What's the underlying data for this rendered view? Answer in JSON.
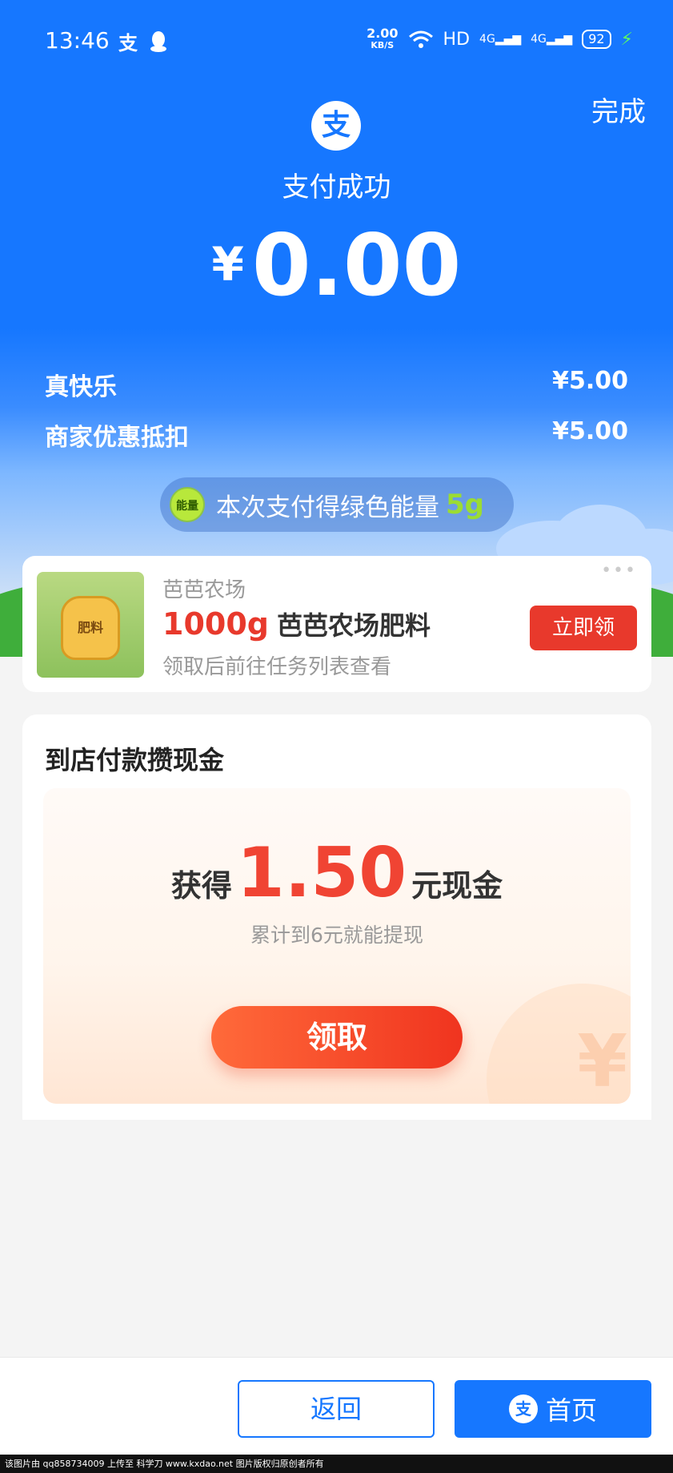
{
  "status_bar": {
    "time": "13:46",
    "speed_value": "2.00",
    "speed_unit": "KB/S",
    "hd": "HD",
    "net1": "4G",
    "net2": "4G",
    "battery": "92"
  },
  "header": {
    "done_label": "完成",
    "logo_glyph": "支",
    "title": "支付成功",
    "currency": "¥",
    "amount": "0.00"
  },
  "breakdown": [
    {
      "label": "真快乐",
      "value": "¥5.00"
    },
    {
      "label": "商家优惠抵扣",
      "value": "¥5.00"
    }
  ],
  "energy": {
    "badge": "能量",
    "text": "本次支付得绿色能量",
    "amount": "5g"
  },
  "farm": {
    "image_label": "肥料",
    "source": "芭芭农场",
    "qty": "1000g",
    "name": "芭芭农场肥料",
    "sub": "领取后前往任务列表查看",
    "button": "立即领",
    "more": "•••"
  },
  "cash": {
    "title": "到店付款攒现金",
    "earn_prefix": "获得",
    "earn_amount": "1.50",
    "earn_suffix": "元现金",
    "sub": "累计到6元就能提现",
    "button": "领取",
    "deco_glyph": "¥"
  },
  "bottom": {
    "back_label": "返回",
    "home_label": "首页",
    "home_logo": "支"
  },
  "watermark": "该图片由 qq858734009 上传至 科学刀 www.kxdao.net 图片版权归原创者所有",
  "colors": {
    "primary": "#1677ff",
    "accent_red": "#e8392c",
    "energy_green": "#9bdc33"
  }
}
